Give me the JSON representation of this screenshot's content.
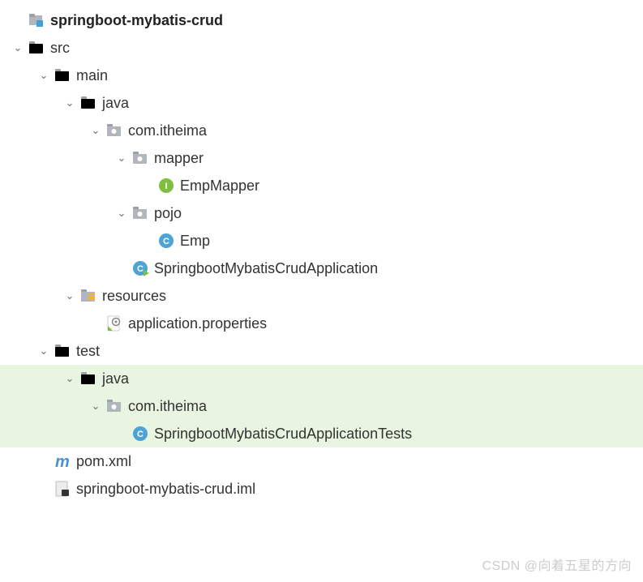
{
  "project": {
    "name": "springboot-mybatis-crud"
  },
  "tree": {
    "src": "src",
    "main": "main",
    "java_main": "java",
    "pkg_main": "com.itheima",
    "mapper_pkg": "mapper",
    "emp_mapper": "EmpMapper",
    "pojo_pkg": "pojo",
    "emp": "Emp",
    "app_class": "SpringbootMybatisCrudApplication",
    "resources": "resources",
    "app_props": "application.properties",
    "test": "test",
    "java_test": "java",
    "pkg_test": "com.itheima",
    "test_class": "SpringbootMybatisCrudApplicationTests",
    "pom": "pom.xml",
    "iml": "springboot-mybatis-crud.iml"
  },
  "watermark": "CSDN @向着五星的方向"
}
